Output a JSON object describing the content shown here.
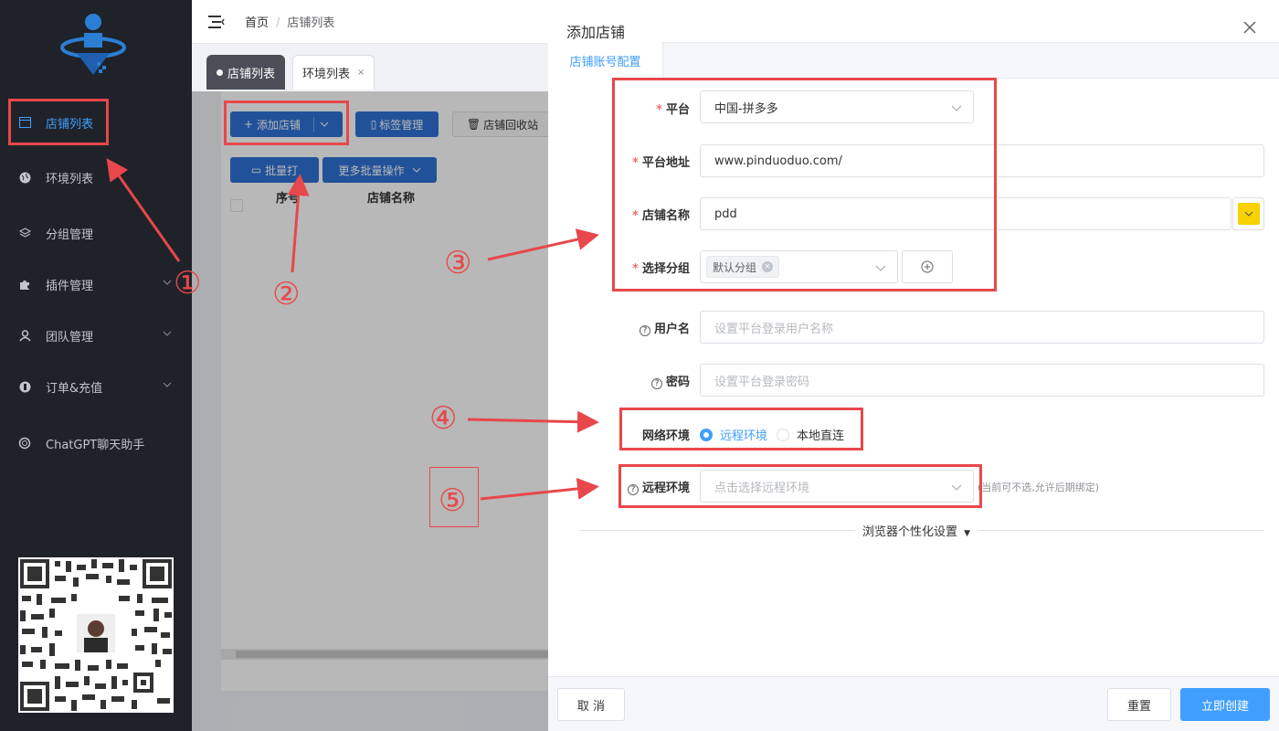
{
  "sidebar": {
    "items": [
      {
        "label": "店铺列表",
        "icon": "window-icon",
        "active": true
      },
      {
        "label": "环境列表",
        "icon": "globe-icon"
      },
      {
        "label": "分组管理",
        "icon": "layers-icon"
      },
      {
        "label": "插件管理",
        "icon": "puzzle-icon"
      },
      {
        "label": "团队管理",
        "icon": "team-icon"
      },
      {
        "label": "订单&充值",
        "icon": "coin-icon"
      },
      {
        "label": "ChatGPT聊天助手",
        "icon": "openai-icon"
      }
    ]
  },
  "breadcrumb": {
    "home": "首页",
    "separator": "/",
    "current": "店铺列表"
  },
  "tabs": [
    {
      "label": "店铺列表",
      "active": true
    },
    {
      "label": "环境列表",
      "close": "×"
    }
  ],
  "toolbar": {
    "add_shop": "添加店铺",
    "tag_manage": "标签管理",
    "recycle": "店铺回收站",
    "batch_open": "批量打",
    "more_batch": "更多批量操作"
  },
  "table": {
    "headers": [
      "序号",
      "店铺名称"
    ]
  },
  "drawer": {
    "title": "添加店铺",
    "tab": "店铺账号配置",
    "fields": {
      "platform": {
        "label": "平台",
        "value": "中国-拼多多"
      },
      "platform_url": {
        "label": "平台地址",
        "value": "www.pinduoduo.com/"
      },
      "shop_name": {
        "label": "店铺名称",
        "value": "pdd"
      },
      "group": {
        "label": "选择分组",
        "tag": "默认分组"
      },
      "username": {
        "label": "用户名",
        "placeholder": "设置平台登录用户名称"
      },
      "password": {
        "label": "密码",
        "placeholder": "设置平台登录密码"
      },
      "network": {
        "label": "网络环境",
        "options": [
          "远程环境",
          "本地直连"
        ],
        "selected": "远程环境"
      },
      "remote_env": {
        "label": "远程环境",
        "placeholder": "点击选择远程环境",
        "hint": "(当前可不选,允许后期绑定)"
      }
    },
    "browser_settings": "浏览器个性化设置",
    "footer": {
      "cancel": "取 消",
      "reset": "重置",
      "create": "立即创建"
    }
  },
  "annotations": [
    "①",
    "②",
    "③",
    "④",
    "⑤"
  ],
  "colors": {
    "accent": "#409eff",
    "primary_button": "#2f72d4",
    "annotation": "#e8474b",
    "sidebar_bg": "#1f2329"
  }
}
